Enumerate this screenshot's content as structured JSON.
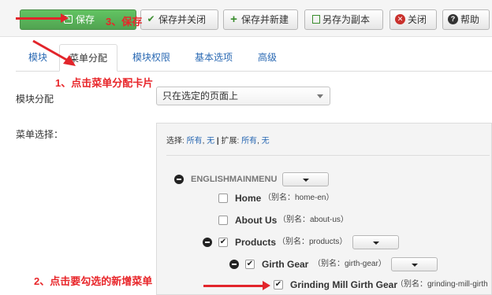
{
  "toolbar": {
    "save": "保存",
    "save_close": "保存并关闭",
    "save_new": "保存并新建",
    "save_copy": "另存为副本",
    "close": "关闭",
    "help": "帮助"
  },
  "annotations": {
    "step1": "1、点击菜单分配卡片",
    "step2": "2、点击要勾选的新增菜单",
    "step3": "3、保存"
  },
  "tabs": [
    {
      "label": "模块",
      "active": false
    },
    {
      "label": "菜单分配",
      "active": true
    },
    {
      "label": "模块权限",
      "active": false
    },
    {
      "label": "基本选项",
      "active": false
    },
    {
      "label": "高级",
      "active": false
    }
  ],
  "module_assignment": {
    "label": "模块分配",
    "selected": "只在选定的页面上"
  },
  "menu_selection": {
    "label": "菜单选择：",
    "select_label": "选择:",
    "select_all": "所有",
    "select_none": "无",
    "expand_label": "扩展:",
    "expand_all": "所有",
    "expand_none": "无",
    "separator": ",",
    "menu_name": "ENGLISHMAINMENU",
    "items": [
      {
        "title": "Home",
        "alias": "（别名：home-en）",
        "checked": false
      },
      {
        "title": "About Us",
        "alias": "（别名：about-us）",
        "checked": false
      },
      {
        "title": "Products",
        "alias": "（别名：products）",
        "checked": true
      },
      {
        "title": "Girth Gear",
        "alias": "（别名：girth-gear）",
        "checked": true
      },
      {
        "title": "Grinding Mill Girth Gear",
        "alias": "（别名：grinding-mill-girth",
        "checked": true
      }
    ]
  },
  "colors": {
    "accent_green": "#51a351",
    "link_blue": "#2a69b3",
    "annotation_red": "#e8262a"
  },
  "icons": {
    "save": "edit-icon",
    "save_close": "check-icon",
    "save_new": "plus-icon",
    "save_copy": "copy-icon",
    "close": "close-circle-icon",
    "help": "question-circle-icon",
    "collapse": "minus-circle-icon",
    "checkbox": "check-mark"
  }
}
